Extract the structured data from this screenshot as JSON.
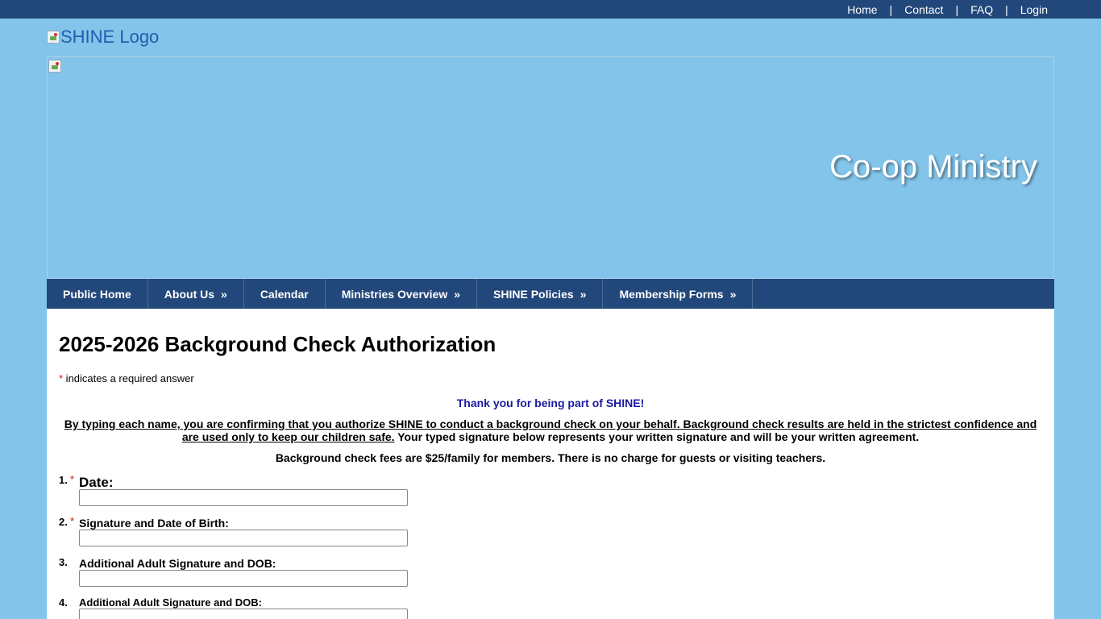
{
  "topnav": {
    "links": [
      "Home",
      "Contact",
      "FAQ",
      "Login"
    ],
    "separator": "|"
  },
  "logo": {
    "alt": "SHINE Logo"
  },
  "banner": {
    "title": "Co-op Ministry"
  },
  "mainnav": {
    "items": [
      {
        "label": "Public Home",
        "arrow": ""
      },
      {
        "label": "About Us",
        "arrow": "»"
      },
      {
        "label": "Calendar",
        "arrow": ""
      },
      {
        "label": "Ministries Overview",
        "arrow": "»"
      },
      {
        "label": "SHINE Policies",
        "arrow": "»"
      },
      {
        "label": "Membership Forms",
        "arrow": "»"
      }
    ]
  },
  "form": {
    "title": "2025-2026 Background Check Authorization",
    "required_star": "*",
    "required_note": " indicates a required answer",
    "thanks": "Thank you for being part of SHINE!",
    "confirm_underlined": "By typing each name, you are confirming that you authorize SHINE to conduct a background check on your behalf.  Background check results are held in the strictest confidence and are used only to keep our children safe.",
    "confirm_plain": " Your typed signature below represents your written signature and will be your written agreement.",
    "fees": "Background check fees are $25/family for members.  There is no charge for guests or visiting teachers.",
    "questions": [
      {
        "number": "1.",
        "required": "*",
        "label": "Date:",
        "value": ""
      },
      {
        "number": "2.",
        "required": "*",
        "label": "Signature and Date of Birth:",
        "value": ""
      },
      {
        "number": "3.",
        "required": "",
        "label": "Additional Adult Signature and DOB:",
        "value": ""
      },
      {
        "number": "4.",
        "required": "",
        "label": "Additional Adult Signature and DOB:",
        "value": ""
      }
    ]
  },
  "colors": {
    "page_bg": "#83c4ea",
    "nav_bg": "#22477a",
    "thanks_text": "#1a1aa0",
    "required_star": "#d01010"
  }
}
